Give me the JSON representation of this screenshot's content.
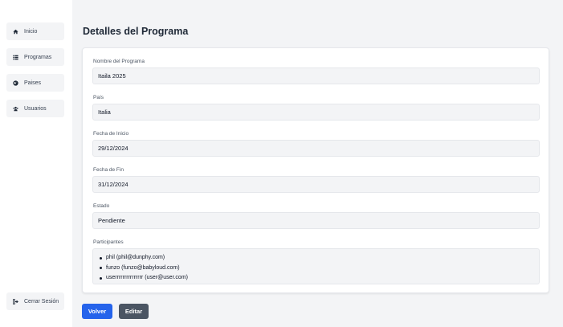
{
  "sidebar": {
    "items": [
      {
        "label": "Inicio",
        "icon": "home-icon"
      },
      {
        "label": "Programas",
        "icon": "list-icon"
      },
      {
        "label": "Paises",
        "icon": "globe-icon"
      },
      {
        "label": "Usuarios",
        "icon": "users-icon"
      }
    ],
    "logout": {
      "label": "Cerrar Sesión",
      "icon": "logout-icon"
    }
  },
  "page": {
    "title": "Detalles del Programa"
  },
  "details": {
    "nombre": {
      "label": "Nombre del Programa",
      "value": "Itaila 2025"
    },
    "pais": {
      "label": "País",
      "value": "Italia"
    },
    "fecha_inicio": {
      "label": "Fecha de Inicio",
      "value": "29/12/2024"
    },
    "fecha_fin": {
      "label": "Fecha de Fin",
      "value": "31/12/2024"
    },
    "estado": {
      "label": "Estado",
      "value": "Pendiente"
    },
    "participantes": {
      "label": "Participantes",
      "items": [
        "phil (phil@dunphy.com)",
        "funzo (funzo@babyloud.com)",
        "userrrrrrrrrrrrrrr (user@user.com)"
      ]
    }
  },
  "actions": {
    "back_label": "Volver",
    "edit_label": "Editar"
  },
  "colors": {
    "primary": "#2563eb",
    "secondary": "#4b5563",
    "background": "#f3f4f6"
  }
}
